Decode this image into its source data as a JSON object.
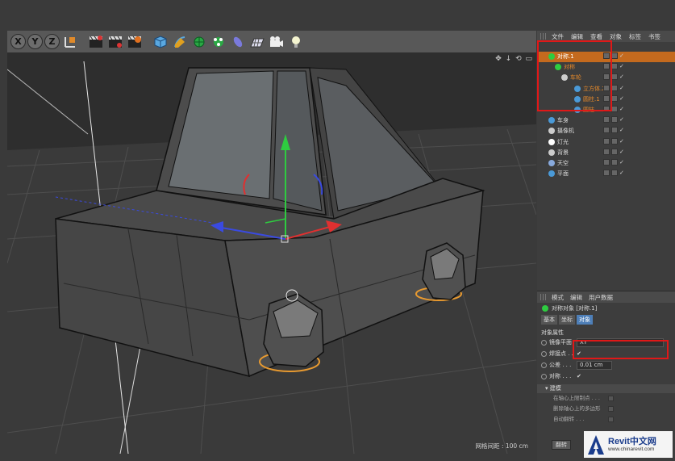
{
  "toolbar": {
    "axis_buttons": [
      "X",
      "Y",
      "Z"
    ]
  },
  "viewport": {
    "grid_spacing_label": "网格间距 : 100 cm",
    "nav_icons": "✥ ↓ ⟲ ▭"
  },
  "object_manager": {
    "menu": [
      "文件",
      "编辑",
      "查看",
      "对象",
      "标签",
      "书签"
    ],
    "objects": [
      {
        "name": "对称.1",
        "color": "#2ecc40",
        "icon": "symmetry-icon",
        "highlight": "orange-bg"
      },
      {
        "name": "对称",
        "color": "#2ecc40",
        "icon": "symmetry-icon",
        "highlight": "orange"
      },
      {
        "name": "车轮",
        "color": "#cccccc",
        "icon": "null-icon",
        "highlight": "orange"
      },
      {
        "name": "立方体.2",
        "color": "#4a9ad8",
        "icon": "cube-icon",
        "highlight": "orange"
      },
      {
        "name": "圆柱.1",
        "color": "#4a9ad8",
        "icon": "cylinder-icon",
        "highlight": "orange"
      },
      {
        "name": "圆柱",
        "color": "#4a9ad8",
        "icon": "cylinder-icon",
        "highlight": "orange"
      },
      {
        "name": "车身",
        "color": "#4a9ad8",
        "icon": "polygon-icon",
        "highlight": "none"
      },
      {
        "name": "摄像机",
        "color": "#cccccc",
        "icon": "camera-icon",
        "highlight": "none"
      },
      {
        "name": "灯光",
        "color": "#ffffff",
        "icon": "light-icon",
        "highlight": "none"
      },
      {
        "name": "背景",
        "color": "#cccccc",
        "icon": "background-icon",
        "highlight": "none"
      },
      {
        "name": "天空",
        "color": "#88aadd",
        "icon": "sky-icon",
        "highlight": "none"
      },
      {
        "name": "平面",
        "color": "#4a9ad8",
        "icon": "plane-icon",
        "highlight": "none"
      }
    ]
  },
  "attributes": {
    "menu": [
      "模式",
      "编辑",
      "用户数据"
    ],
    "title": "对称对象 [对称.1]",
    "tabs": [
      "基本",
      "坐标",
      "对象"
    ],
    "active_tab": "对象",
    "section": "对象属性",
    "props": [
      {
        "label": "镜像平面",
        "value": "XY"
      },
      {
        "label": "焊接点 . .",
        "value": "✔"
      },
      {
        "label": "公差 . . .",
        "value": "0.01 cm"
      },
      {
        "label": "对称 . . .",
        "value": "✔"
      }
    ],
    "group": "▾ 建模",
    "sub_options": [
      "在轴心上限制点 . . .",
      "删除轴心上的多边形",
      "自动翻转 . . ."
    ],
    "button": "翻转"
  },
  "watermark": {
    "brand": "Revit中文网",
    "url": "www.chinarevit.com"
  }
}
